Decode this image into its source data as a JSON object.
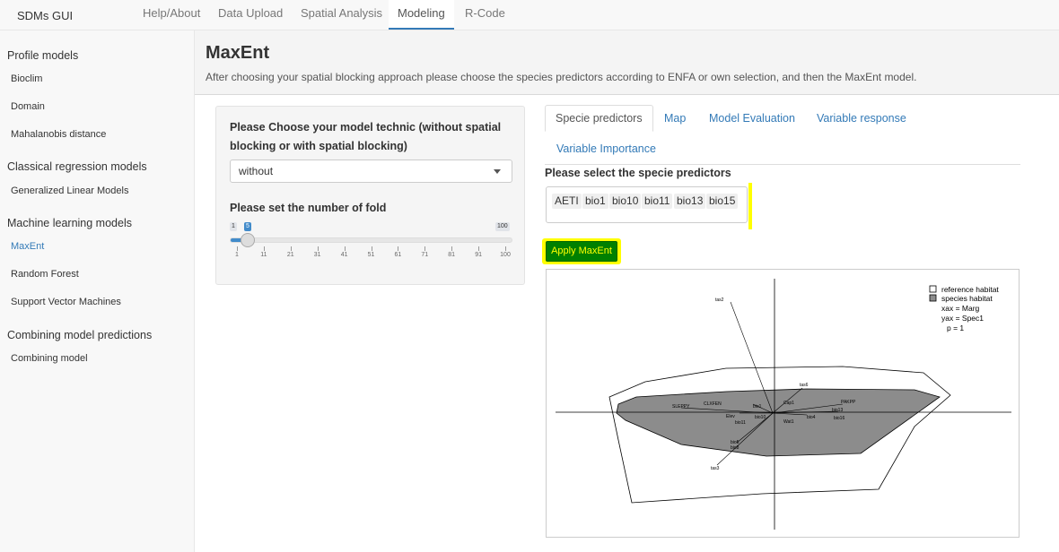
{
  "navbar": {
    "brand": "SDMs GUI",
    "tabs": [
      {
        "label": "Help/About"
      },
      {
        "label": "Data Upload"
      },
      {
        "label": "Spatial Analysis"
      },
      {
        "label": "Modeling"
      },
      {
        "label": "R-Code"
      }
    ],
    "active_tab": "Modeling"
  },
  "sidebar": {
    "sections": [
      {
        "heading": "Profile models",
        "items": [
          "Bioclim",
          "Domain",
          "Mahalanobis distance"
        ]
      },
      {
        "heading": "Classical regression models",
        "items": [
          "Generalized Linear Models"
        ]
      },
      {
        "heading": "Machine learning models",
        "items": [
          "MaxEnt",
          "Random Forest",
          "Support Vector Machines"
        ]
      },
      {
        "heading": "Combining model predictions",
        "items": [
          "Combining model"
        ]
      }
    ],
    "active_item": "MaxEnt"
  },
  "header": {
    "title": "MaxEnt",
    "subtitle": "After choosing your spatial blocking approach please choose the species predictors according to ENFA or own selection, and then the MaxEnt model."
  },
  "well": {
    "technic_label_line1": "Please Choose your model technic (without spatial",
    "technic_label_line2": "blocking or with spatial blocking)",
    "technic_value": "without",
    "fold_label": "Please set the number of fold",
    "slider": {
      "min": "1",
      "max": "100",
      "value": "5",
      "ticks": [
        "1",
        "11",
        "21",
        "31",
        "41",
        "51",
        "61",
        "71",
        "81",
        "91",
        "100"
      ]
    }
  },
  "tabs": {
    "items": [
      "Specie predictors",
      "Map",
      "Model Evaluation",
      "Variable response",
      "Variable Importance"
    ],
    "active": "Specie predictors"
  },
  "predictors": {
    "label": "Please select the specie predictors",
    "selected": [
      "AETI",
      "bio1",
      "bio10",
      "bio11",
      "bio13",
      "bio15"
    ]
  },
  "apply_button": "Apply MaxEnt",
  "plot": {
    "legend": {
      "reference": "reference habitat",
      "species": "species habitat",
      "xax": "xax = Marg",
      "yax": "yax = Spec1",
      "p": "p = 1"
    },
    "colors": {
      "species_fill": "#8c8c8c",
      "reference_fill": "#ffffff"
    }
  },
  "colors": {
    "accent": "#337ab7",
    "highlight": "#ffff00",
    "button_green": "#008000"
  }
}
